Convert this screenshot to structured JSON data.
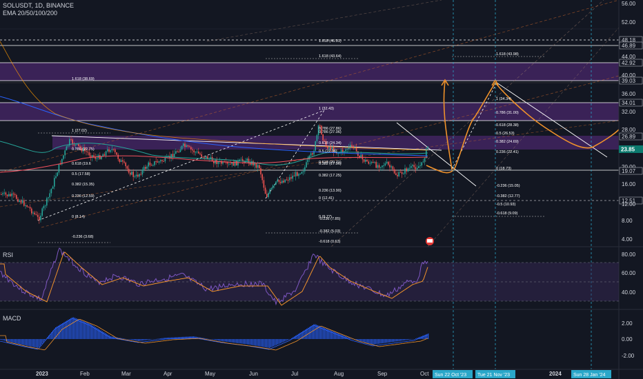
{
  "header": {
    "symbol_line": "SOLUSDT, 1D, BINANCE",
    "ema_label": "EMA 20/50/100/200"
  },
  "panes": {
    "rsi_label": "RSI",
    "macd_label": "MACD"
  },
  "colors": {
    "background": "#131722",
    "purple_zone": "#5b2c83",
    "fib_text": "#ffffff",
    "orange_projection": "#f0922b",
    "price_badge": "#0c7a6e",
    "date_badge": "#2aa7c9",
    "rsi_line": "#7e57c2",
    "macd_hist": "#2962ff"
  },
  "price_axis": {
    "labels": [
      "56.00",
      "52.00",
      "48.18",
      "46.89",
      "44.00",
      "42.92",
      "40.00",
      "39.03",
      "36.00",
      "34.01",
      "32.00",
      "28.00",
      "26.89",
      "23.85",
      "20.00",
      "19.07",
      "16.00",
      "12.51",
      "12.00",
      "8.00",
      "4.00"
    ],
    "current_price": "23.85"
  },
  "rsi_axis": {
    "labels": [
      "80.00",
      "60.00",
      "40.00"
    ]
  },
  "macd_axis": {
    "labels": [
      "2.00",
      "0.00",
      "-2.00"
    ]
  },
  "time_axis": {
    "labels": [
      "2023",
      "Feb",
      "Mar",
      "Apr",
      "May",
      "Jun",
      "Jul",
      "Aug",
      "Sep",
      "Oct",
      "2024"
    ],
    "badges": [
      "Sun 22 Oct '23",
      "Tue 21 Nov '23",
      "Sun 28 Jan '24"
    ]
  },
  "fib_left": {
    "labels": [
      "1.618 (38.69)",
      "1 (27.02)",
      "0.786 (22.75)",
      "0.618 (19.6",
      "0.5 (17.58)",
      "0.382 (15.35)",
      "0.236 (12.59)",
      "0 (8.14)",
      "-0.236 (3.68)"
    ]
  },
  "fib_mid": {
    "labels": [
      "1.618 (46.91)",
      "1.618 (43.64)",
      "1 (32.43)",
      "0.786 (27.86)",
      "0.786 (27.06)",
      "0.618 (24.34)",
      "0.5 (22.06)",
      "0.618 (20.71)",
      "0.382 (17.96)",
      "0.382 (17.25)",
      "0.236 (13.90)",
      "0 (12.41)",
      "0 (9.77)",
      "-0.236 (7.85)",
      "-0.382 (5.03)",
      "-0.618 (0.63)"
    ]
  },
  "fib_right": {
    "labels": [
      "1.618 (43.98)",
      "1 (34.34)",
      "0.786 (31.00)",
      "0.618 (28.38)",
      "0.5 (26.53)",
      "0.382 (24.69)",
      "0.236 (22.41)",
      "0 (18.73)",
      "-0.236 (15.05)",
      "-0.382 (12.77)",
      "-0.5 (10.93)",
      "-0.618 (9.09)"
    ]
  }
}
